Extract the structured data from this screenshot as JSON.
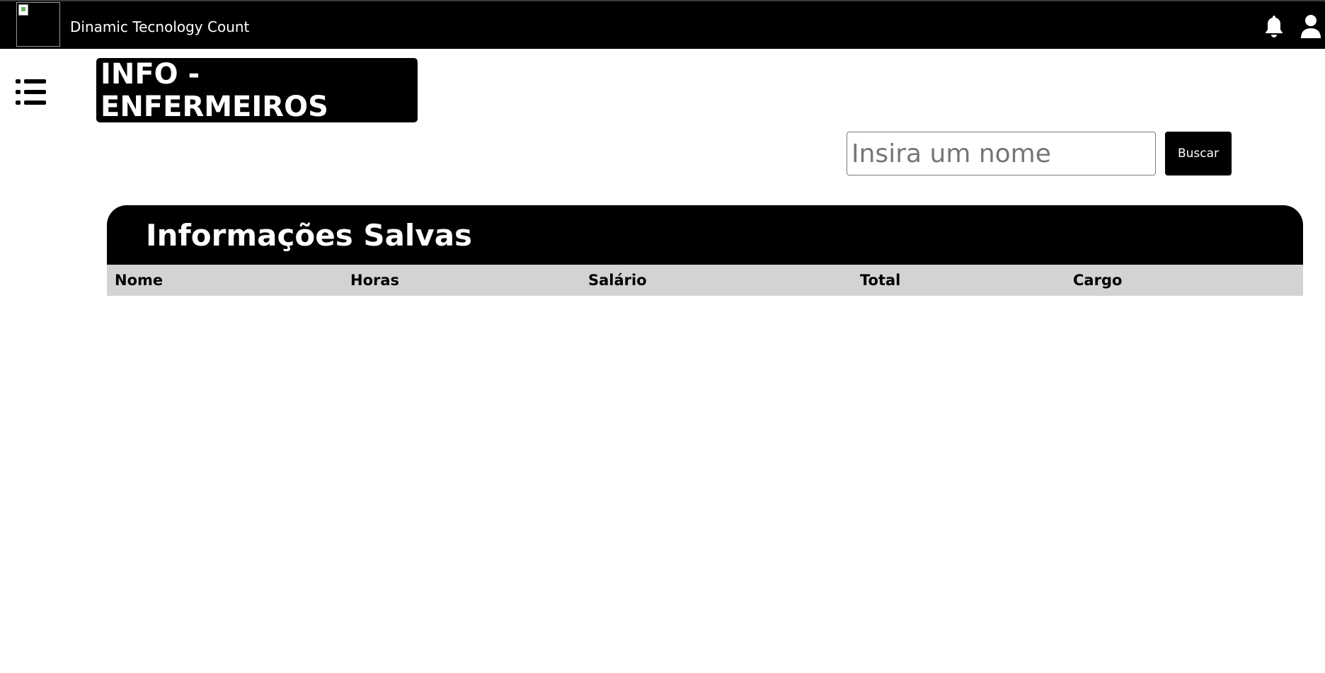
{
  "topbar": {
    "logo_icon": "broken-image-icon",
    "app_title": "Dinamic Tecnology Count",
    "bell_icon": "bell-icon",
    "user_icon": "user-icon"
  },
  "sidebar": {
    "menu_icon": "list-menu-icon"
  },
  "page": {
    "title": "INFO -\nENFERMEIROS"
  },
  "search": {
    "placeholder": "Insira um nome",
    "value": "",
    "button_label": "Buscar"
  },
  "panel": {
    "title": "Informações Salvas",
    "columns": [
      "Nome",
      "Horas",
      "Salário",
      "Total",
      "Cargo"
    ],
    "rows": []
  },
  "colors": {
    "primary": "#000000",
    "header_row_bg": "#d3d3d3",
    "text_on_primary": "#ffffff"
  }
}
